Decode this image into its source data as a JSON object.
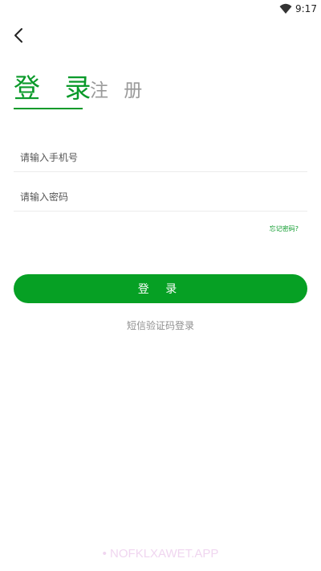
{
  "status_bar": {
    "time": "9:17",
    "wifi_icon": "wifi-icon"
  },
  "nav": {
    "back_icon": "chevron-left-icon"
  },
  "tabs": {
    "login": "登 录",
    "register": "注 册"
  },
  "form": {
    "phone_placeholder": "请输入手机号",
    "password_placeholder": "请输入密码",
    "forgot_password": "忘记密码?",
    "login_button": "登 录",
    "sms_login": "短信验证码登录"
  },
  "watermark": "• NOFKLXAWET.APP",
  "colors": {
    "accent": "#06a024",
    "inactive_tab": "#9a9a9a",
    "hint": "#8f8f8f"
  }
}
